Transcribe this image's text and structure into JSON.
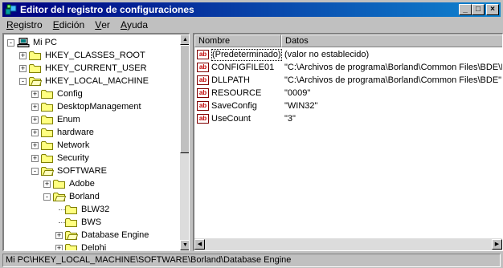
{
  "window": {
    "title": "Editor del registro de configuraciones",
    "controls": [
      "minimize",
      "maximize",
      "close"
    ]
  },
  "menu": [
    {
      "label": "Registro",
      "accel": "R",
      "rest": "egistro"
    },
    {
      "label": "Edición",
      "accel": "E",
      "rest": "dición"
    },
    {
      "label": "Ver",
      "accel": "V",
      "rest": "er"
    },
    {
      "label": "Ayuda",
      "accel": "A",
      "rest": "yuda"
    }
  ],
  "tree": [
    {
      "label": "Mi PC",
      "icon": "computer-icon",
      "expander": "-",
      "level": 0
    },
    {
      "label": "HKEY_CLASSES_ROOT",
      "icon": "folder-icon",
      "expander": "+",
      "level": 1
    },
    {
      "label": "HKEY_CURRENT_USER",
      "icon": "folder-icon",
      "expander": "+",
      "level": 1
    },
    {
      "label": "HKEY_LOCAL_MACHINE",
      "icon": "folder-open-icon",
      "expander": "-",
      "level": 1
    },
    {
      "label": "Config",
      "icon": "folder-icon",
      "expander": "+",
      "level": 2
    },
    {
      "label": "DesktopManagement",
      "icon": "folder-icon",
      "expander": "+",
      "level": 2
    },
    {
      "label": "Enum",
      "icon": "folder-icon",
      "expander": "+",
      "level": 2
    },
    {
      "label": "hardware",
      "icon": "folder-icon",
      "expander": "+",
      "level": 2
    },
    {
      "label": "Network",
      "icon": "folder-icon",
      "expander": "+",
      "level": 2
    },
    {
      "label": "Security",
      "icon": "folder-icon",
      "expander": "+",
      "level": 2
    },
    {
      "label": "SOFTWARE",
      "icon": "folder-open-icon",
      "expander": "-",
      "level": 2
    },
    {
      "label": "Adobe",
      "icon": "folder-icon",
      "expander": "+",
      "level": 3
    },
    {
      "label": "Borland",
      "icon": "folder-open-icon",
      "expander": "-",
      "level": 3
    },
    {
      "label": "BLW32",
      "icon": "folder-icon",
      "expander": "",
      "level": 4
    },
    {
      "label": "BWS",
      "icon": "folder-icon",
      "expander": "",
      "level": 4
    },
    {
      "label": "Database Engine",
      "icon": "folder-open-icon",
      "expander": "+",
      "level": 4
    },
    {
      "label": "Delphi",
      "icon": "folder-icon",
      "expander": "+",
      "level": 4
    }
  ],
  "list": {
    "columns": [
      "Nombre",
      "Datos"
    ],
    "rows": [
      {
        "name": "(Predeterminado)",
        "data": "(valor no establecido)"
      },
      {
        "name": "CONFIGFILE01",
        "data": "\"C:\\Archivos de programa\\Borland\\Common Files\\BDE\\IDA"
      },
      {
        "name": "DLLPATH",
        "data": "\"C:\\Archivos de programa\\Borland\\Common Files\\BDE\""
      },
      {
        "name": "RESOURCE",
        "data": "\"0009\""
      },
      {
        "name": "SaveConfig",
        "data": "\"WIN32\""
      },
      {
        "name": "UseCount",
        "data": "\"3\""
      }
    ],
    "value_icon": "ab"
  },
  "status": "Mi PC\\HKEY_LOCAL_MACHINE\\SOFTWARE\\Borland\\Database Engine",
  "colors": {
    "titlebar": "#000080",
    "face": "#c0c0c0",
    "folder": "#ffff80"
  }
}
